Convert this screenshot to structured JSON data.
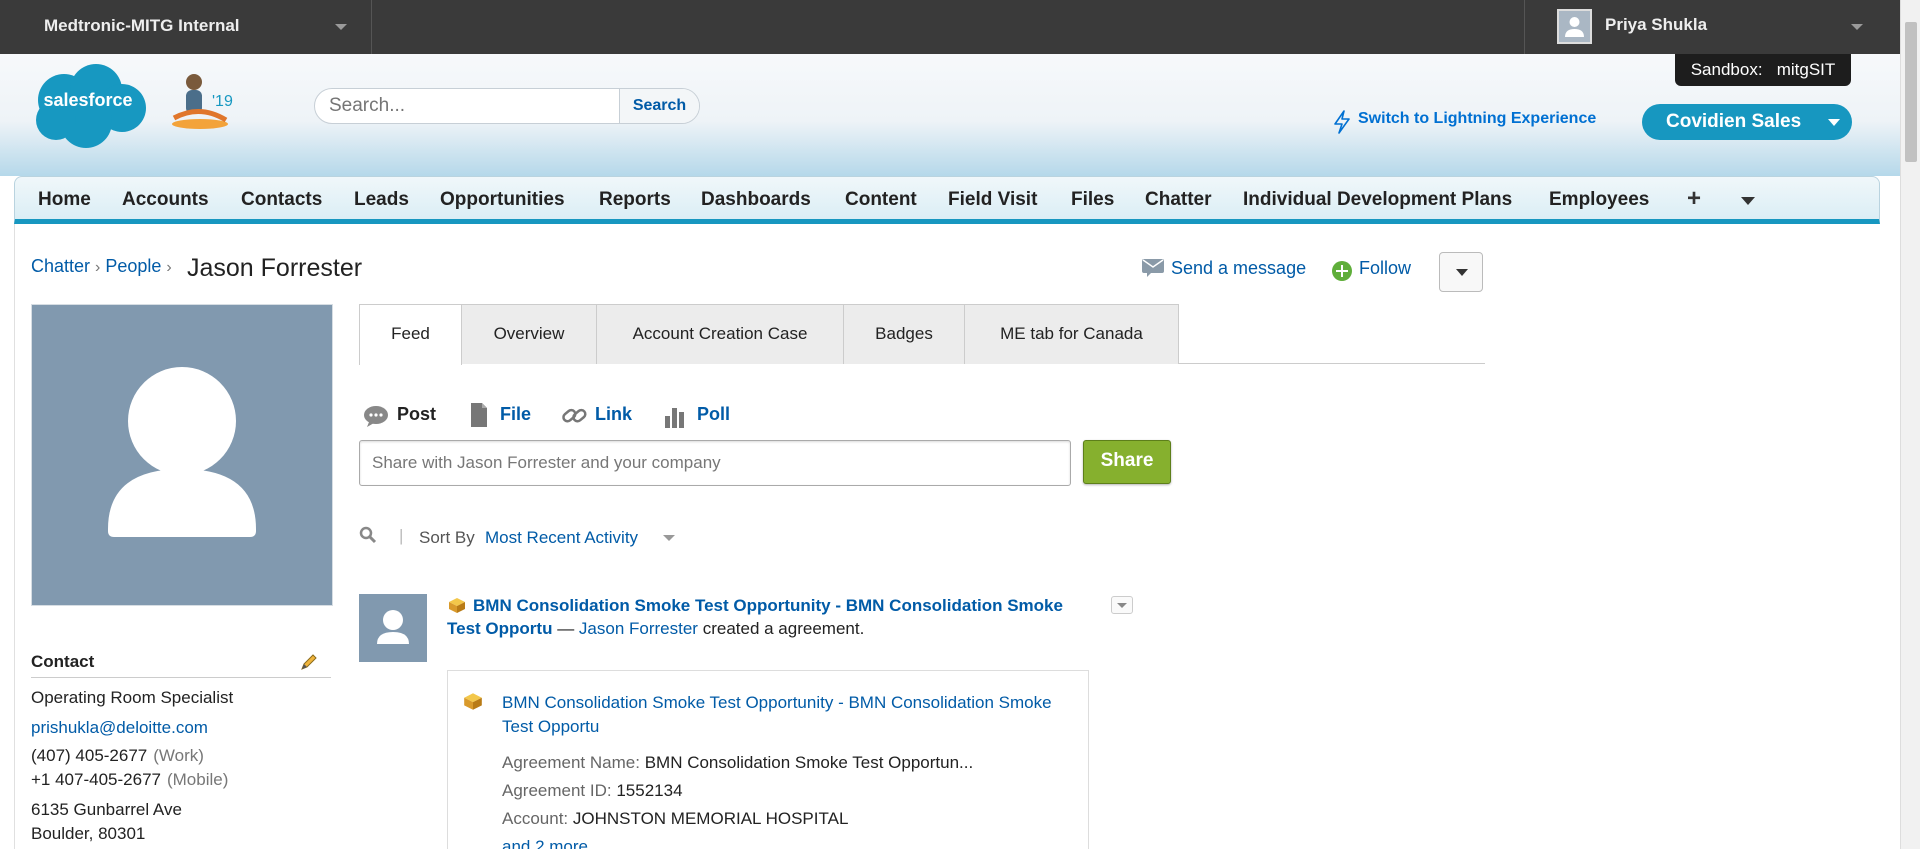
{
  "topbar": {
    "org_name": "Medtronic-MITG Internal",
    "user_name": "Priya Shukla"
  },
  "header": {
    "logo_text": "salesforce",
    "mascot_year": "'19",
    "search_placeholder": "Search...",
    "search_button": "Search",
    "sandbox_label": "Sandbox:",
    "sandbox_name": "mitgSIT",
    "lightning_link": "Switch to Lightning Experience",
    "app_name": "Covidien Sales"
  },
  "nav": {
    "tabs": [
      "Home",
      "Accounts",
      "Contacts",
      "Leads",
      "Opportunities",
      "Reports",
      "Dashboards",
      "Content",
      "Field Visit",
      "Files",
      "Chatter",
      "Individual Development Plans",
      "Employees"
    ],
    "plus": "+"
  },
  "profile": {
    "breadcrumb": [
      "Chatter",
      "People"
    ],
    "name": "Jason Forrester",
    "send_message": "Send a message",
    "follow": "Follow",
    "tabs": [
      "Feed",
      "Overview",
      "Account Creation Case",
      "Badges",
      "ME tab for Canada"
    ],
    "contact": {
      "heading": "Contact",
      "title": "Operating Room Specialist",
      "email": "prishukla@deloitte.com",
      "work_phone": "(407) 405-2677",
      "work_label": "(Work)",
      "mobile_phone": "+1 407-405-2677",
      "mobile_label": "(Mobile)",
      "address_line1": "6135 Gunbarrel Ave",
      "address_line2": "Boulder, 80301"
    }
  },
  "publisher": {
    "post": "Post",
    "file": "File",
    "link": "Link",
    "poll": "Poll",
    "share_placeholder": "Share with Jason Forrester and your company",
    "share_button": "Share",
    "sort_by_label": "Sort By",
    "sort_value": "Most Recent Activity"
  },
  "feed_item": {
    "record_link": "BMN Consolidation Smoke Test Opportunity - BMN Consolidation Smoke Test Opportu",
    "separator": "—",
    "actor": "Jason Forrester",
    "action": "created a agreement.",
    "card": {
      "title": "BMN Consolidation Smoke Test Opportunity - BMN Consolidation Smoke Test Opportu",
      "agreement_name_label": "Agreement Name:",
      "agreement_name": "BMN Consolidation Smoke Test Opportun...",
      "agreement_id_label": "Agreement ID:",
      "agreement_id": "1552134",
      "account_label": "Account:",
      "account": "JOHNSTON MEMORIAL HOSPITAL",
      "more": "and 2 more"
    }
  },
  "colors": {
    "accent": "#1797c0",
    "link": "#015ba7",
    "share_green": "#86b02e",
    "avatar_blue": "#8199af"
  }
}
